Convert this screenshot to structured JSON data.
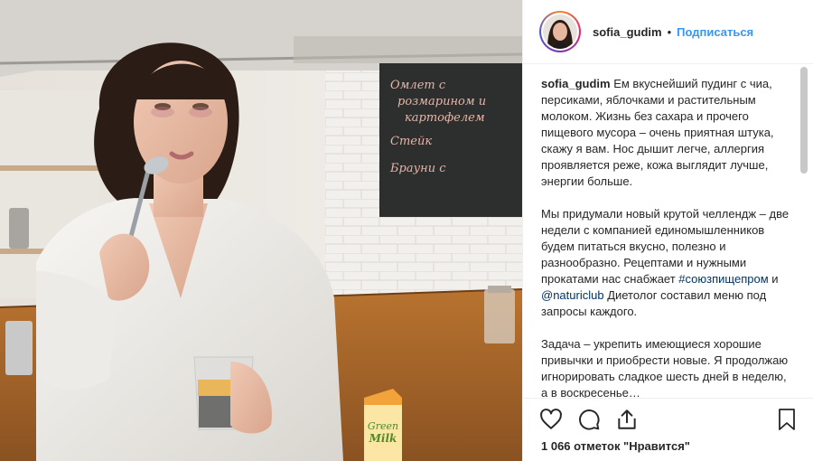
{
  "post": {
    "username": "sofia_gudim",
    "separator": "•",
    "follow_label": "Подписаться",
    "photo_alt": "Woman in white shirt eating chia pudding with a spoon in a kitchen",
    "likes_text": "1 066 отметок \"Нравится\""
  },
  "caption": {
    "author": "sofia_gudim",
    "p1": "Ем вкуснейший пудинг с чиа, персиками, яблочками и растительным молоком. Жизнь без сахара и прочего пищевого мусора – очень приятная штука, скажу я вам. Нос дышит легче, аллергия проявляется реже, кожа выглядит лучше, энергии больше.",
    "p2_start": "Мы придумали новый крутой челлендж – две недели с компанией единомышленников будем питаться вкусно, полезно и разнообразно. Рецептами и нужными прокатами нас снабжает ",
    "hashtag": "#союзпищепром",
    "and": " и ",
    "mention": "@naturiclub",
    "p2_end": " Диетолог составил меню под запросы каждого.",
    "p3": "Задача – укрепить имеющиеся хорошие привычки и приобрести новые. Я продолжаю игнорировать сладкое шесть дней в неделю, а в воскресенье…"
  },
  "board_lines": [
    "Омлет с",
    "розмарином и",
    "картофелем",
    "Стейк ",
    "Брауни с"
  ],
  "product": {
    "brand_top": "Green",
    "brand_bottom": "Milk"
  },
  "icons": {
    "like": "heart-icon",
    "comment": "comment-icon",
    "share": "share-icon",
    "save": "bookmark-icon"
  },
  "colors": {
    "link": "#003569",
    "follow": "#3897f0",
    "text": "#262626",
    "border": "#efefef"
  }
}
